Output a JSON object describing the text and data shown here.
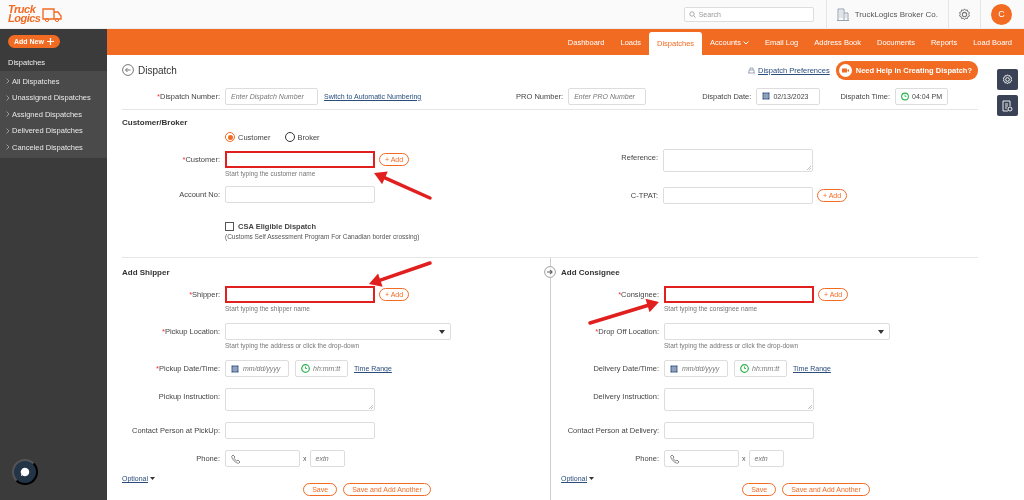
{
  "logo": {
    "line1": "Truck",
    "line2": "Logics"
  },
  "header": {
    "search_placeholder": "Search",
    "company": "TruckLogics Broker Co.",
    "avatar": "C"
  },
  "sidebar": {
    "add_button": "Add New",
    "section": "Dispatches",
    "items": [
      "All Dispatches",
      "Unassigned Dispatches",
      "Assigned Dispatches",
      "Delivered Dispatches",
      "Canceled Dispatches"
    ]
  },
  "nav": [
    {
      "label": "Dashboard",
      "selected": false,
      "caret": false
    },
    {
      "label": "Loads",
      "selected": false,
      "caret": false
    },
    {
      "label": "Dispatches",
      "selected": true,
      "caret": false
    },
    {
      "label": "Accounts",
      "selected": false,
      "caret": true
    },
    {
      "label": "Email Log",
      "selected": false,
      "caret": false
    },
    {
      "label": "Address Book",
      "selected": false,
      "caret": false
    },
    {
      "label": "Documents",
      "selected": false,
      "caret": false
    },
    {
      "label": "Reports",
      "selected": false,
      "caret": false
    },
    {
      "label": "Load Board",
      "selected": false,
      "caret": false
    }
  ],
  "page": {
    "title": "Dispatch",
    "preferences_link": "Dispatch Preferences",
    "help_button": "Need Help In Creating Dispatch?"
  },
  "dispatch_row": {
    "dispatch_number": {
      "mark": "*",
      "label": "Dispatch Number:",
      "placeholder": "Enter Dispatch Number"
    },
    "switch_link": "Switch to Automatic Numbering",
    "pro_number": {
      "label": "PRO Number:",
      "placeholder": "Enter PRO Number"
    },
    "dispatch_date": {
      "label": "Dispatch Date:",
      "value": "02/13/2023"
    },
    "dispatch_time": {
      "label": "Dispatch Time:",
      "value": "04:04 PM"
    }
  },
  "customer_broker": {
    "title": "Customer/Broker",
    "left_rows": [
      {
        "kind": "radio_group",
        "options": [
          {
            "label": "Customer",
            "selected": true
          },
          {
            "label": "Broker",
            "selected": false
          }
        ]
      },
      {
        "kind": "text",
        "mark": "*",
        "label": "Customer:",
        "highlighted": true,
        "hint": "Start typing the customer name",
        "add_button": "+ Add"
      },
      {
        "kind": "text",
        "label": "Account No:",
        "highlighted": false
      },
      {
        "kind": "checkbox",
        "label": "CSA Eligible Dispatch",
        "checked": false,
        "note": "(Customs Self Assessment Program For Canadian border crossing)"
      }
    ],
    "right_rows": [
      {
        "kind": "textarea",
        "label": "Reference:"
      },
      {
        "kind": "text",
        "label": "C-TPAT:",
        "highlighted": false,
        "add_button": "+ Add"
      }
    ]
  },
  "stops": [
    {
      "title": "Add Shipper",
      "rows": [
        {
          "kind": "text",
          "mark": "*",
          "label": "Shipper:",
          "highlighted": true,
          "hint": "Start typing the shipper name",
          "add_button": "+ Add"
        },
        {
          "kind": "select",
          "mark": "*",
          "label": "Pickup Location:",
          "hint": "Start typing the address or click the drop-down"
        },
        {
          "kind": "datetime",
          "mark": "*",
          "label": "Pickup Date/Time:",
          "date_placeholder": "mm/dd/yyyy",
          "time_placeholder": "hh:mm:tt",
          "link": "Time Range"
        },
        {
          "kind": "textarea",
          "label": "Pickup Instruction:"
        },
        {
          "kind": "text",
          "label": "Contact Person at PickUp:",
          "highlighted": false
        },
        {
          "kind": "phone",
          "label": "Phone:",
          "separator": "x",
          "ext_placeholder": "extn"
        }
      ],
      "optional_link": "Optional",
      "buttons": [
        "Save",
        "Save and Add Another"
      ]
    },
    {
      "title": "Add Consignee",
      "rows": [
        {
          "kind": "text",
          "mark": "*",
          "label": "Consignee:",
          "highlighted": true,
          "hint": "Start typing the consignee name",
          "add_button": "+ Add"
        },
        {
          "kind": "select",
          "mark": "*",
          "label": "Drop Off Location:",
          "hint": "Start typing the address or click the drop-down"
        },
        {
          "kind": "datetime",
          "label": "Delivery Date/Time:",
          "date_placeholder": "mm/dd/yyyy",
          "time_placeholder": "hh:mm:tt",
          "link": "Time Range"
        },
        {
          "kind": "textarea",
          "label": "Delivery Instruction:"
        },
        {
          "kind": "text",
          "label": "Contact Person at Delivery:",
          "highlighted": false
        },
        {
          "kind": "phone",
          "label": "Phone:",
          "separator": "x",
          "ext_placeholder": "extn"
        }
      ],
      "optional_link": "Optional",
      "buttons": [
        "Save",
        "Save and Add Another"
      ]
    }
  ]
}
